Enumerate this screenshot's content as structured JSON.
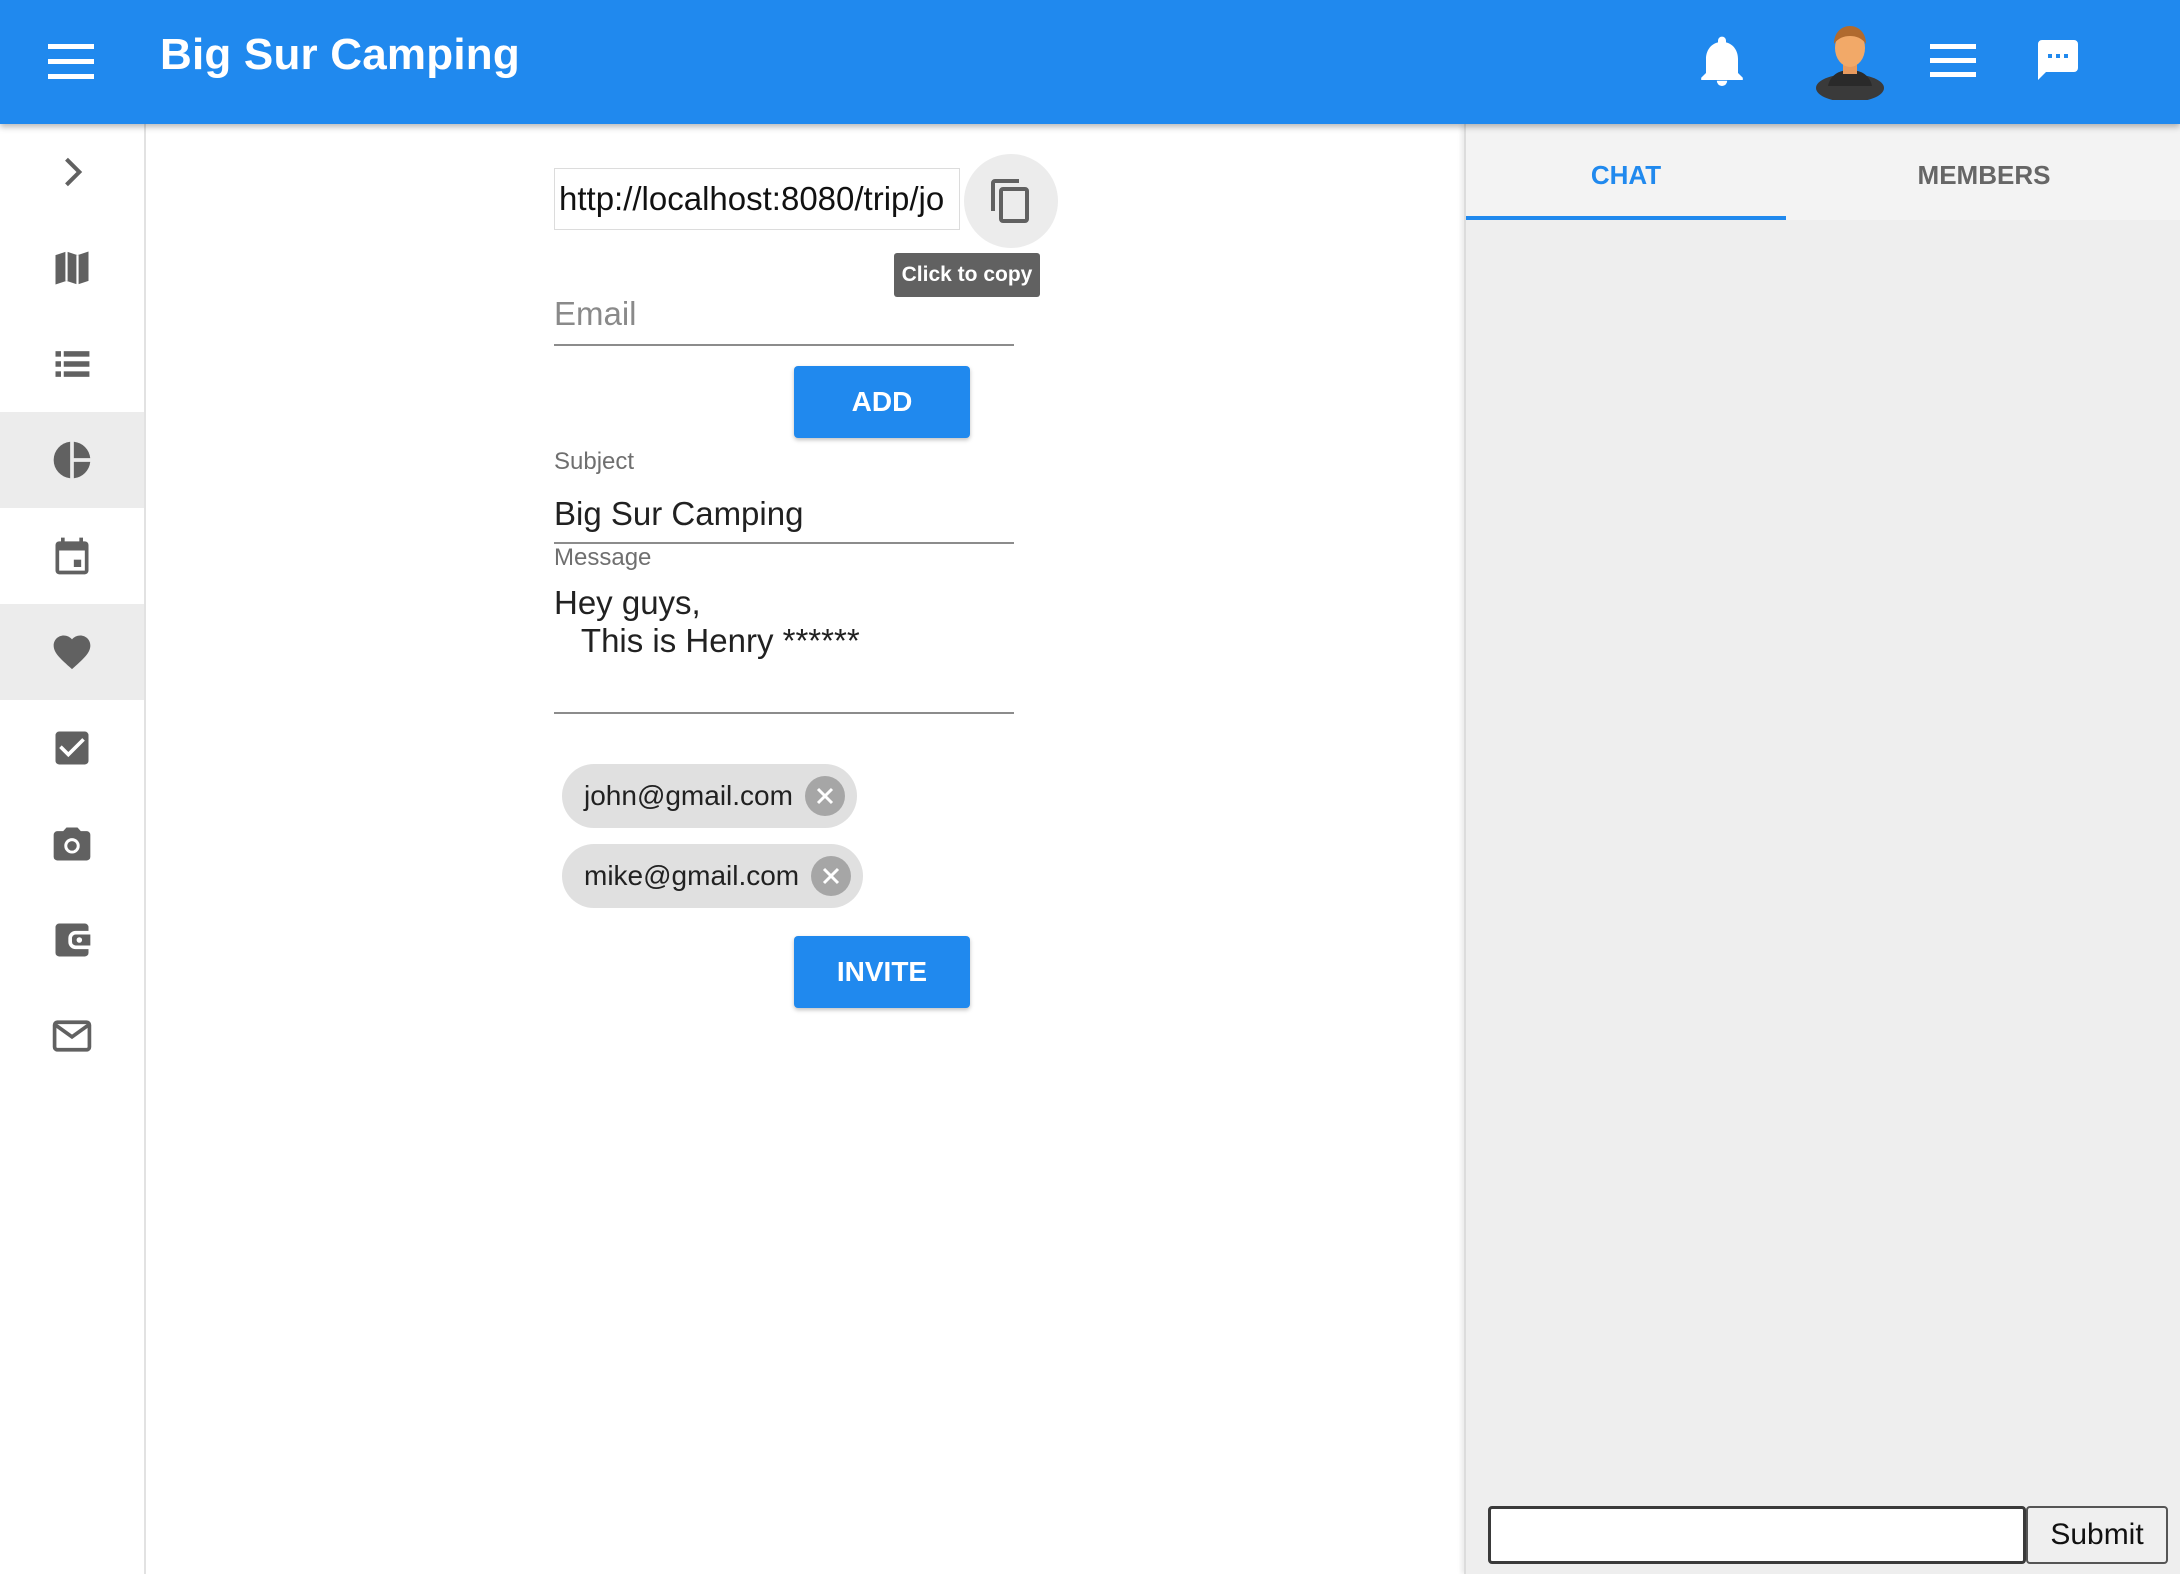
{
  "header": {
    "title": "Big Sur Camping",
    "icons": [
      "menu-icon",
      "bell-icon",
      "user-avatar-icon",
      "list-icon",
      "chat-bubble-icon"
    ],
    "color": "#2089ee"
  },
  "sidebar": {
    "items": [
      {
        "icon": "chevron-right-icon",
        "active": false
      },
      {
        "icon": "map-icon",
        "active": false
      },
      {
        "icon": "list-view-icon",
        "active": false
      },
      {
        "icon": "pie-chart-icon",
        "active": true
      },
      {
        "icon": "calendar-icon",
        "active": false
      },
      {
        "icon": "heart-icon",
        "active": true
      },
      {
        "icon": "checkbox-icon",
        "active": false
      },
      {
        "icon": "camera-icon",
        "active": false
      },
      {
        "icon": "wallet-icon",
        "active": false
      },
      {
        "icon": "mail-icon",
        "active": false
      }
    ]
  },
  "invite_form": {
    "share_url": "http://localhost:8080/trip/jo",
    "copy_tooltip": "Click to copy",
    "email_placeholder": "Email",
    "email_value": "",
    "add_label": "ADD",
    "subject_label": "Subject",
    "subject_value": "Big Sur Camping",
    "message_label": "Message",
    "message_value": "Hey guys,\n   This is Henry ******",
    "recipients": [
      "john@gmail.com",
      "mike@gmail.com"
    ],
    "invite_label": "INVITE"
  },
  "right_panel": {
    "tabs": [
      {
        "label": "CHAT",
        "active": true
      },
      {
        "label": "MEMBERS",
        "active": false
      }
    ],
    "chat_input_value": "",
    "submit_label": "Submit"
  }
}
